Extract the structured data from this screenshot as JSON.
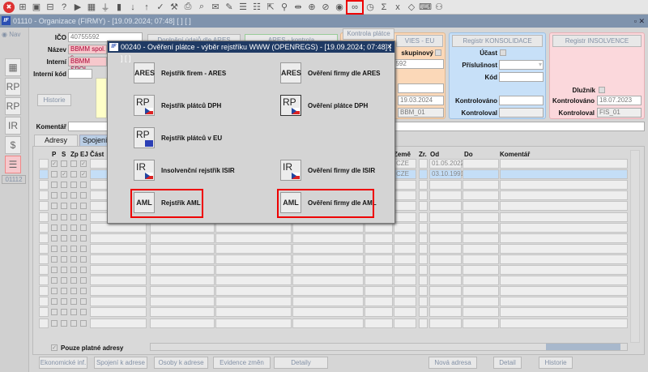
{
  "toolbar": {
    "icons": [
      "close-icon",
      "add-icon",
      "save-icon",
      "remove-icon",
      "help-icon",
      "play-icon",
      "calendar-icon",
      "filter-icon",
      "chart-icon",
      "sort-asc-icon",
      "sort-desc-icon",
      "check-icon",
      "wrench-icon",
      "print-icon",
      "print-preview-icon",
      "mail-icon",
      "edit-icon",
      "list-icon",
      "checklist-icon",
      "export-icon",
      "attach-icon",
      "split-icon",
      "globe-icon",
      "compass-icon",
      "eye-icon",
      "glasses-icon",
      "clock-icon",
      "sum-icon",
      "excel-icon",
      "code-icon",
      "keyboard-icon",
      "reader-icon"
    ]
  },
  "window": {
    "title": "01110 - Organizace (FIRMY) - [19.09.2024; 07:48]  [ ]  [ ]",
    "logo": "IF",
    "nav": "Nav",
    "nav_code": "01112"
  },
  "form": {
    "ico_label": "IČO",
    "ico": "40755592",
    "nazev_label": "Název",
    "nazev": "BBMM spol. s",
    "interni_label": "Interní",
    "interni": "BBMM SPOL.",
    "interni_kod_label": "Interní kód",
    "interni_kod": "",
    "historie": "Historie",
    "komentar_label": "Komentář",
    "btn_doplneni": "Doplnění údajů dle ARES",
    "btn_ares_kontrola": "ARES - kontrola",
    "btn_kontrola_platce": "Kontrola plátce"
  },
  "vies": {
    "title": "VIES - EU",
    "skupinovy": "skupinový",
    "dic": "5592",
    "d_label": "d",
    "kontrolovano": "19.03.2024",
    "o_label": "o",
    "kontroloval": "BBM_01",
    "l_label": "l"
  },
  "konsolidace": {
    "title": "Registr KONSOLIDACE",
    "ucast": "Účast",
    "prislusnost": "Příslušnost",
    "kod": "Kód",
    "kontrolovano": "Kontrolováno",
    "kontroloval": "Kontroloval"
  },
  "insolvence": {
    "title": "Registr INSOLVENCE",
    "dluznik": "Dlužník",
    "kontrolovano_label": "Kontrolováno",
    "kontrolovano": "18.07.2023",
    "kontroloval_label": "Kontroloval",
    "kontroloval": "FIS_01"
  },
  "tabs": [
    "Adresy",
    "Spojení"
  ],
  "grid": {
    "headers": {
      "p": "P",
      "s": "S",
      "zp": "Zp",
      "ej": "EJ",
      "cast": "Část",
      "zeme": "Země",
      "zr": "Zr.",
      "od": "Od",
      "do": "Do",
      "komentar": "Komentář"
    },
    "rows": [
      {
        "p": true,
        "s": false,
        "zp": false,
        "ej": true,
        "zeme": "CZE",
        "od": "01.05.2022"
      },
      {
        "p": false,
        "s": true,
        "zp": false,
        "ej": true,
        "zeme": "CZE",
        "od": "03.10.1991",
        "selected": true
      }
    ],
    "empty_rows": 14,
    "pouze_platne": "Pouze platné adresy"
  },
  "bottom_buttons": [
    "Ekonomické inf.",
    "Spojení k adrese",
    "Osoby k adrese",
    "Evidence změn",
    "Detaily"
  ],
  "right_buttons": [
    "Nová adresa",
    "Detail",
    "Historie"
  ],
  "dialog": {
    "title": "00240 - Ověření plátce - výběr rejstříku WWW (OPENREGS) - [19.09.2024; 07:48]  [ ]  [ ]",
    "close": "×",
    "items": [
      {
        "icon": "ARES",
        "label": "Rejstřík firem - ARES"
      },
      {
        "icon": "ARES",
        "label": "Ověření firmy dle ARES"
      },
      {
        "icon": "RP",
        "label": "Rejstřík plátců DPH"
      },
      {
        "icon": "RP",
        "label": "Ověření plátce DPH"
      },
      {
        "icon": "RP",
        "label": "Rejstřík plátců v EU"
      },
      {
        "icon": "IR",
        "label": "Insolvenční rejstřík ISIR"
      },
      {
        "icon": "IR",
        "label": "Ověření firmy dle ISIR"
      },
      {
        "icon": "AML",
        "label": "Rejstřík AML"
      },
      {
        "icon": "AML",
        "label": "Ověření firmy dle AML"
      }
    ]
  },
  "colors": {
    "highlight": "#e00000",
    "title_bar": "#1f3a64",
    "selected_row": "#c4def7"
  }
}
